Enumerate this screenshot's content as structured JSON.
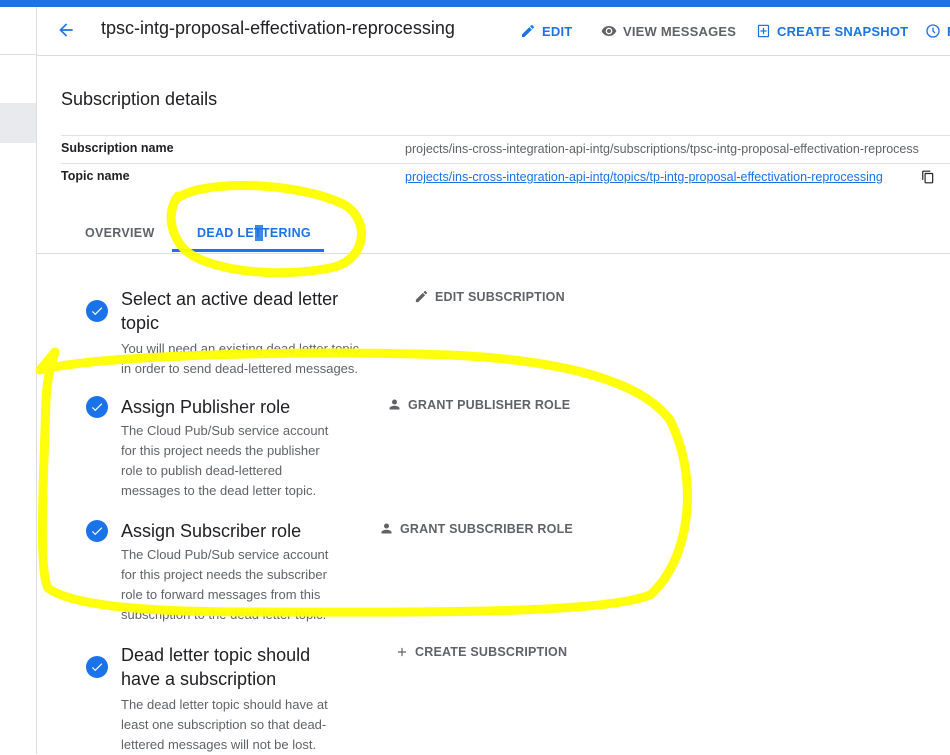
{
  "header": {
    "title": "tpsc-intg-proposal-effectivation-reprocessing",
    "edit_label": "EDIT",
    "view_messages_label": "VIEW MESSAGES",
    "create_snapshot_label": "CREATE SNAPSHOT",
    "truncated_label": "R"
  },
  "details": {
    "section_title": "Subscription details",
    "subscription_name_label": "Subscription name",
    "subscription_name_value": "projects/ins-cross-integration-api-intg/subscriptions/tpsc-intg-proposal-effectivation-reprocess",
    "topic_name_label": "Topic name",
    "topic_name_value": "projects/ins-cross-integration-api-intg/topics/tp-intg-proposal-effectivation-reprocessing"
  },
  "tabs": [
    {
      "label": "OVERVIEW",
      "active": false
    },
    {
      "label": "DEAD LETTERING",
      "active": true
    }
  ],
  "steps": [
    {
      "title_line1": "Select an active dead letter",
      "title_line2": "topic",
      "desc_lines": [
        "You will need an existing dead letter topic",
        "in order to send dead-lettered messages."
      ],
      "action_label": "EDIT SUBSCRIPTION",
      "action_icon": "pencil-icon"
    },
    {
      "title_line1": "Assign Publisher role",
      "desc_lines": [
        "The Cloud Pub/Sub service account",
        "for this project needs the publisher",
        "role to publish dead-lettered",
        "messages to the dead letter topic."
      ],
      "action_label": "GRANT PUBLISHER ROLE",
      "action_icon": "person-icon"
    },
    {
      "title_line1": "Assign Subscriber role",
      "desc_lines": [
        "The Cloud Pub/Sub service account",
        "for this project needs the subscriber",
        "role to forward messages from this",
        "subscription to the dead letter topic."
      ],
      "action_label": "GRANT SUBSCRIBER ROLE",
      "action_icon": "person-icon"
    },
    {
      "title_line1": "Dead letter topic should",
      "title_line2": "have a subscription",
      "desc_lines": [
        "The dead letter topic should have at",
        "least one subscription so that dead-",
        "lettered messages will not be lost."
      ],
      "action_label": "CREATE SUBSCRIPTION",
      "action_icon": "plus-icon"
    }
  ],
  "colors": {
    "accent": "#1a73e8",
    "highlight": "#ffff00",
    "text_secondary": "#5f6368"
  }
}
